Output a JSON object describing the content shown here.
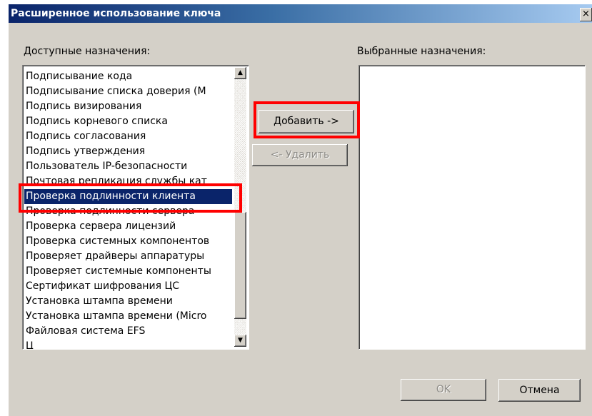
{
  "dialog": {
    "title": "Расширенное использование ключа",
    "close_glyph": "×"
  },
  "available": {
    "label": "Доступные назначения:",
    "items": [
      {
        "label": "Подписывание кода",
        "selected": false
      },
      {
        "label": "Подписывание списка доверия (М",
        "selected": false
      },
      {
        "label": "Подпись визирования",
        "selected": false
      },
      {
        "label": "Подпись корневого списка",
        "selected": false
      },
      {
        "label": "Подпись согласования",
        "selected": false
      },
      {
        "label": "Подпись утверждения",
        "selected": false
      },
      {
        "label": "Пользователь IP-безопасности",
        "selected": false
      },
      {
        "label": "Почтовая репликация службы кат",
        "selected": false
      },
      {
        "label": "Проверка подлинности клиента",
        "selected": true
      },
      {
        "label": "Проверка подлинности сервера",
        "selected": false
      },
      {
        "label": "Проверка сервера лицензий",
        "selected": false
      },
      {
        "label": "Проверка системных компонентов",
        "selected": false
      },
      {
        "label": "Проверяет драйверы аппаратуры",
        "selected": false
      },
      {
        "label": "Проверяет системные компоненты",
        "selected": false
      },
      {
        "label": "Сертификат шифрования ЦС",
        "selected": false
      },
      {
        "label": "Установка штампа времени",
        "selected": false
      },
      {
        "label": "Установка штампа времени (Micro",
        "selected": false
      },
      {
        "label": "Файловая система EFS",
        "selected": false
      },
      {
        "label": "Ц",
        "selected": false
      }
    ]
  },
  "selected_list": {
    "label": "Выбранные назначения:",
    "items": []
  },
  "buttons": {
    "add": "Добавить ->",
    "remove": "<- Удалить",
    "ok": "OK",
    "cancel": "Отмена"
  },
  "scrollbar": {
    "up_glyph": "▲",
    "down_glyph": "▼"
  },
  "colors": {
    "highlight": "#ff0000",
    "selection": "#0a246a",
    "dialog_face": "#d4d0c8"
  }
}
